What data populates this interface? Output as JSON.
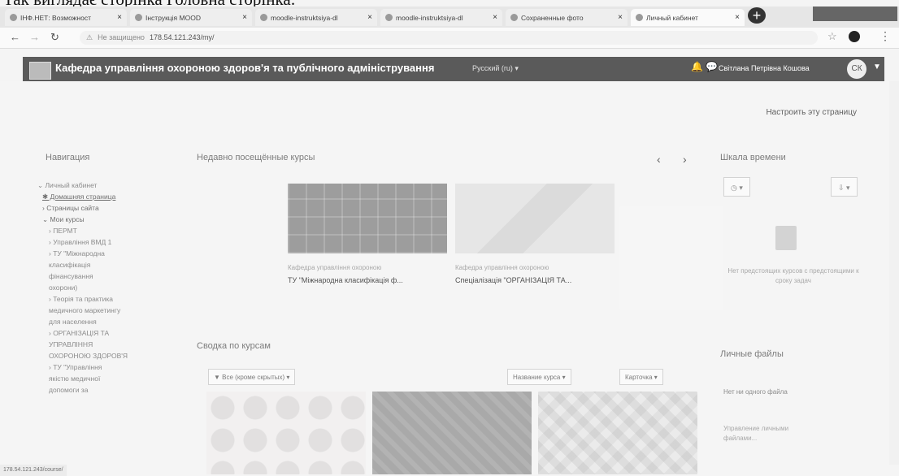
{
  "doc": {
    "heading": "Так виглядає сторінка Головна сторінка:"
  },
  "browser": {
    "tabs": [
      {
        "title": "ІНФ.НЕТ: Возможност"
      },
      {
        "title": "Інструкція MOOD"
      },
      {
        "title": "moodle-instruktsiya-dl"
      },
      {
        "title": "moodle-instruktsiya-dl"
      },
      {
        "title": "Сохраненные фото"
      },
      {
        "title": "Личный кабинет"
      }
    ],
    "address": {
      "secure_label": "Не защищено",
      "url": "178.54.121.243/my/"
    },
    "status_url": "178.54.121.243/course/"
  },
  "header": {
    "site_title": "Кафедра управління охороною здоров'я та публічного адміністрування",
    "language": "Русский (ru) ▾",
    "user_name": "Світлана Петрівна Кошова",
    "avatar_initials": "СК"
  },
  "page": {
    "customize_label": "Настроить эту страницу"
  },
  "navigation": {
    "title": "Навигация",
    "items": [
      {
        "label": "⌄ Личный кабинет"
      },
      {
        "label": "✱ Домашняя страница"
      },
      {
        "label": "› Страницы сайта"
      },
      {
        "label": "⌄ Мои курсы"
      },
      {
        "label": "› ПЕРМТ"
      },
      {
        "label": "› Управління ВМД 1"
      },
      {
        "label": "› ТУ \"Міжнародна"
      },
      {
        "label": "класифікація"
      },
      {
        "label": "фінансування"
      },
      {
        "label": "охорони)"
      },
      {
        "label": "› Теорія та практика"
      },
      {
        "label": "медичного маркетингу"
      },
      {
        "label": "для населення"
      },
      {
        "label": "› ОРГАНІЗАЦІЯ ТА"
      },
      {
        "label": "УПРАВЛІННЯ"
      },
      {
        "label": "ОХОРОНОЮ ЗДОРОВ'Я"
      },
      {
        "label": "› ТУ \"Управління"
      },
      {
        "label": "якістю медичної"
      },
      {
        "label": "допомоги за"
      }
    ]
  },
  "recent_courses": {
    "title": "Недавно посещённые курсы",
    "prev": "‹",
    "next": "›",
    "cards": [
      {
        "category": "Кафедра управління охороною",
        "name": "ТУ \"Міжнародна класифікація ф..."
      },
      {
        "category": "Кафедра управління охороною",
        "name": "Спеціалізація \"ОРГАНІЗАЦІЯ ТА..."
      }
    ]
  },
  "course_overview": {
    "title": "Сводка по курсам",
    "filter_label": "▼ Все (кроме скрытых) ▾",
    "sort_label": "Название курса ▾",
    "view_label": "Карточка ▾"
  },
  "timeline": {
    "title": "Шкала времени",
    "filter_label": "◷ ▾",
    "sort_label": "⇩ ▾",
    "empty_text": "Нет предстоящих курсов с предстоящими к сроку задач"
  },
  "private_files": {
    "title": "Личные файлы",
    "empty_text": "Нет ни одного файла",
    "manage_label": "Управление личными файлами..."
  },
  "colors": {
    "header_bg": "#5a5a5a",
    "link": "#444444"
  }
}
